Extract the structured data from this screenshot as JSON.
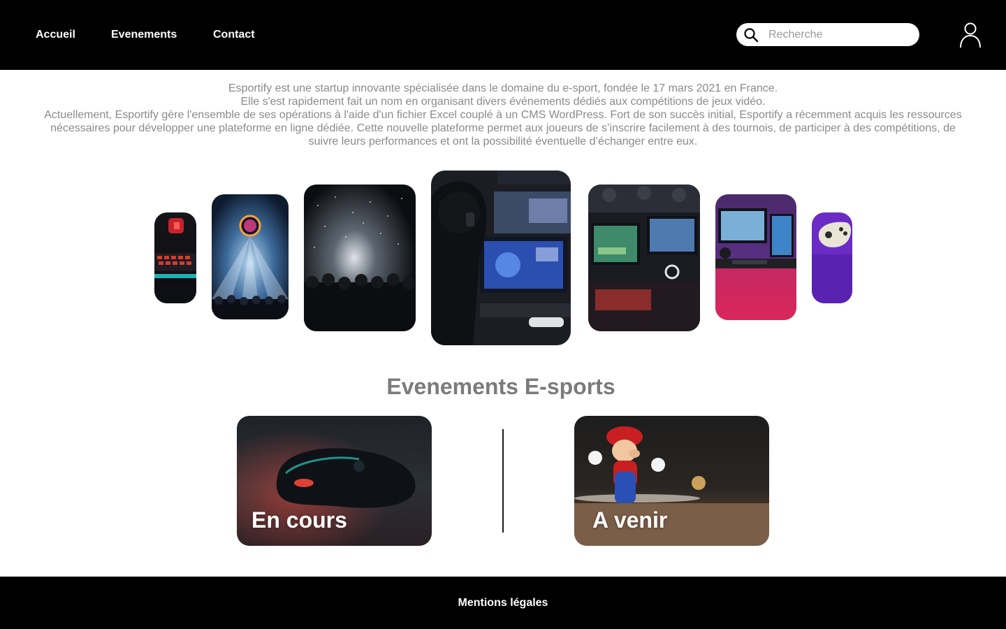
{
  "header": {
    "nav": [
      {
        "label": "Accueil"
      },
      {
        "label": "Evenements"
      },
      {
        "label": "Contact"
      }
    ],
    "search": {
      "placeholder": "Recherche",
      "icon": "search-icon"
    },
    "user_icon": "user-icon"
  },
  "intro": {
    "lines": [
      "Esportify est une startup innovante spécialisée dans le domaine du e-sport, fondée le 17 mars 2021 en France.",
      "Elle s'est rapidement fait un nom en organisant divers événements dédiés aux compétitions de jeux vidéo.",
      "Actuellement, Esportify gère l'ensemble de ses opérations à l'aide d'un fichier Excel couplé à un CMS WordPress. Fort de son succès initial, Esportify a récemment acquis les ressources nécessaires pour développer une plateforme en ligne dédiée. Cette nouvelle plateforme permet aux joueurs de s’inscrire facilement à des tournois, de participer à des compétitions, de suivre leurs performances et ont la possibilité éventuelle d’échanger entre eux."
    ]
  },
  "carousel": {
    "images": [
      "gaming-keyboard-photo",
      "ea-sports-stage-photo",
      "concert-crowd-photo",
      "esports-player-photo",
      "lan-party-photo",
      "gaming-setup-photo",
      "controller-photo"
    ]
  },
  "events": {
    "title": "Evenements E-sports",
    "cards": [
      {
        "label": "En cours",
        "image": "controller-photo"
      },
      {
        "label": "A venir",
        "image": "mario-figure-photo"
      }
    ]
  },
  "footer": {
    "link": "Mentions légales"
  },
  "colors": {
    "header_bg": "#000000",
    "footer_bg": "#000000",
    "text_muted": "#8a8a8a",
    "title": "#7b7b7b"
  }
}
